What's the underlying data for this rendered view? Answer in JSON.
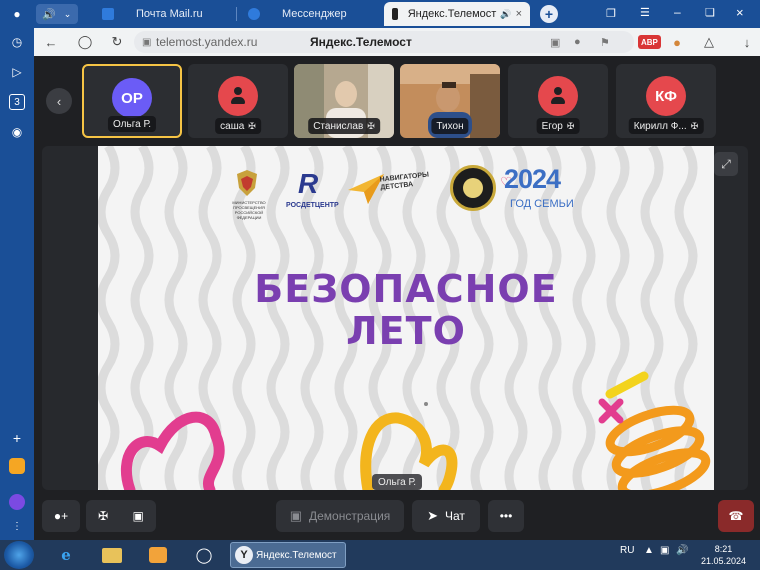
{
  "browser": {
    "tabs": [
      {
        "label": "Почта Mail.ru",
        "active": false
      },
      {
        "label": "Мессенджер",
        "active": false
      },
      {
        "label": "Яндекс.Телемост",
        "active": true
      }
    ],
    "url": "telemost.yandex.ru",
    "page_title": "Яндекс.Телемост",
    "sidebar_badge": "3",
    "abp": "ABP"
  },
  "participants": [
    {
      "initials": "ОР",
      "name": "Ольга Р.",
      "avatar_color": "#6b5cf6",
      "type": "initials",
      "muted": false,
      "selected": true
    },
    {
      "initials": "",
      "name": "саша",
      "avatar_color": "#e5484d",
      "type": "person",
      "muted": true,
      "selected": false
    },
    {
      "initials": "",
      "name": "Станислав",
      "avatar_color": "",
      "type": "video",
      "muted": true,
      "selected": false
    },
    {
      "initials": "",
      "name": "Тихон",
      "avatar_color": "",
      "type": "video",
      "muted": false,
      "selected": false
    },
    {
      "initials": "",
      "name": "Егор",
      "avatar_color": "#e5484d",
      "type": "person",
      "muted": true,
      "selected": false
    },
    {
      "initials": "КФ",
      "name": "Кирилл Ф...",
      "avatar_color": "#e5484d",
      "type": "initials",
      "muted": true,
      "selected": false
    }
  ],
  "slide": {
    "logos": {
      "ministry": "МИНИСТЕРСТВО ПРОСВЕЩЕНИЯ РОССИЙСКОЙ ФЕДЕРАЦИИ",
      "rosdetcenter": "РОСДЕТЦЕНТР",
      "navigators_line1": "НАВИГАТОРЫ",
      "navigators_line2": "ДЕТСТВА",
      "year": "2024",
      "year_sub": "ГОД СЕМЬИ"
    },
    "headline_line1": "БЕЗОПАСНОЕ",
    "headline_line2": "ЛЕТО",
    "speaker": "Ольга Р."
  },
  "controls": {
    "demo_label": "Демонстрация",
    "chat_label": "Чат"
  },
  "taskbar": {
    "active_app": "Яндекс.Телемост",
    "lang": "RU",
    "time": "8:21",
    "date": "21.05.2024"
  },
  "colors": {
    "accent": "#f6c445",
    "headline": "#7a3fb0",
    "browser": "#1a4f97",
    "end_call": "#8a2a2a"
  }
}
